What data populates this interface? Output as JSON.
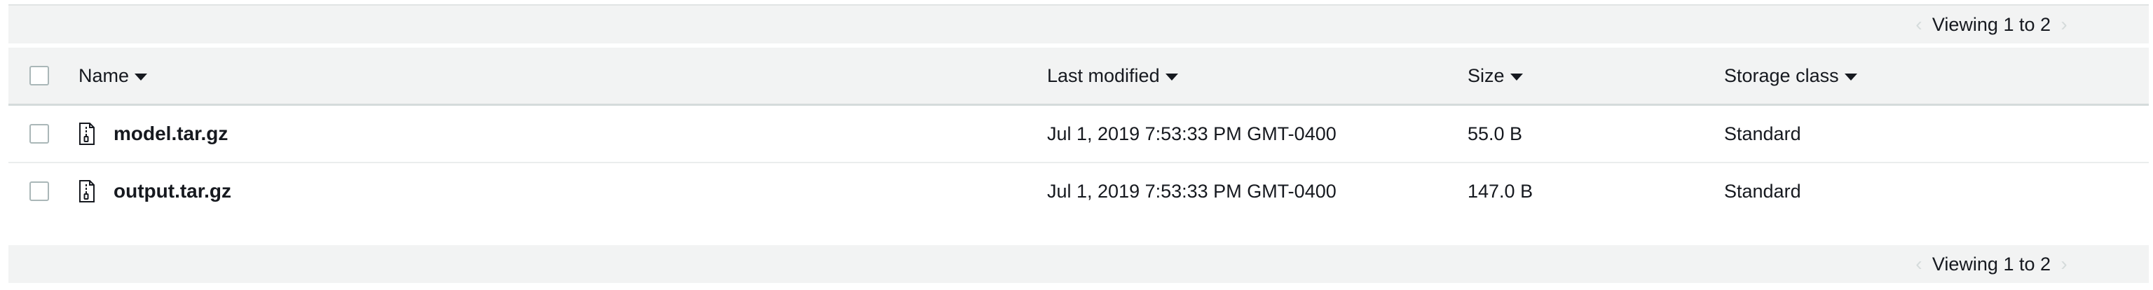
{
  "pagination": {
    "top_label": "Viewing 1 to 2",
    "bottom_label": "Viewing 1 to 2"
  },
  "table": {
    "columns": [
      {
        "label": "Name"
      },
      {
        "label": "Last modified"
      },
      {
        "label": "Size"
      },
      {
        "label": "Storage class"
      }
    ],
    "rows": [
      {
        "name": "model.tar.gz",
        "last_modified": "Jul 1, 2019 7:53:33 PM GMT-0400",
        "size": "55.0 B",
        "storage_class": "Standard",
        "icon": "archive-file-icon"
      },
      {
        "name": "output.tar.gz",
        "last_modified": "Jul 1, 2019 7:53:33 PM GMT-0400",
        "size": "147.0 B",
        "storage_class": "Standard",
        "icon": "archive-file-icon"
      }
    ]
  },
  "colors": {
    "header_bg": "#f2f3f3",
    "text": "#16191f",
    "checkbox_border": "#aab7b8",
    "disabled_chevron": "#d5dbdb"
  }
}
